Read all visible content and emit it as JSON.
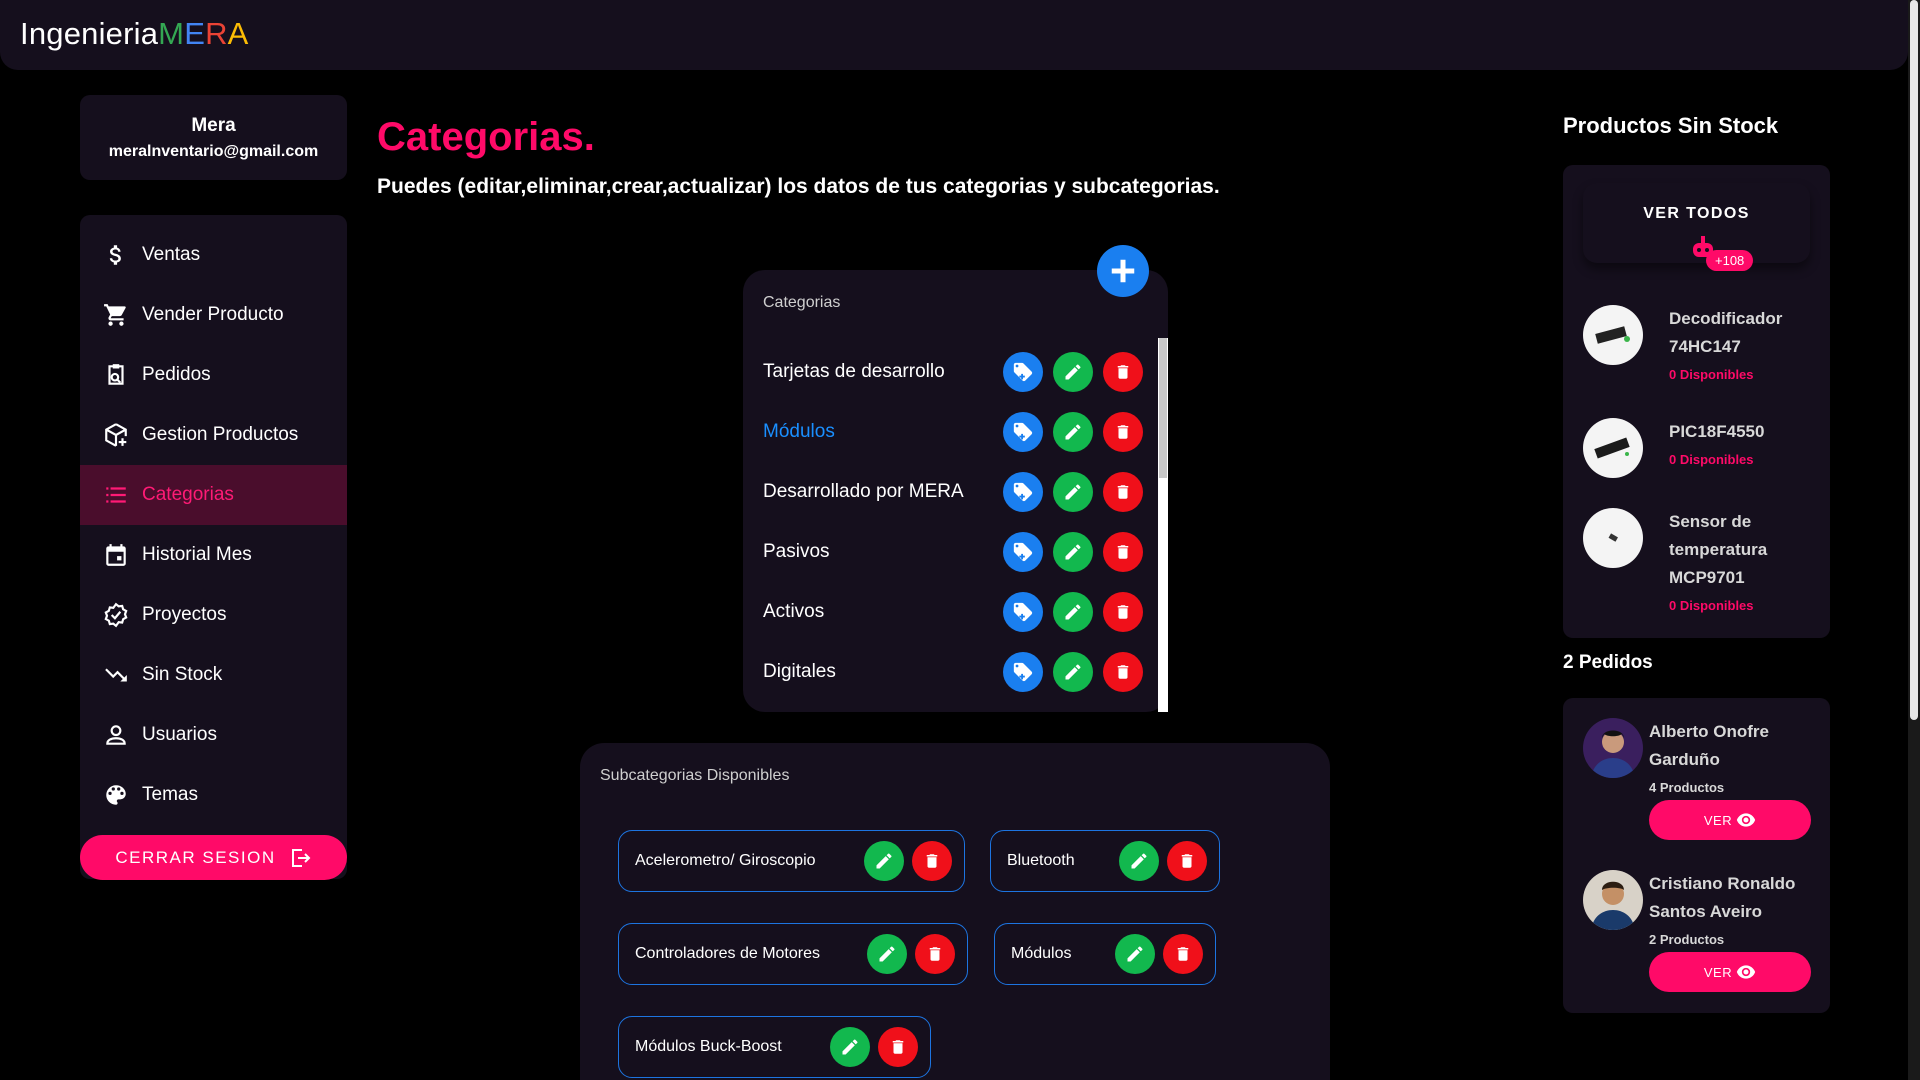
{
  "brand": {
    "prefix": "Ingenieria",
    "m": "M",
    "e": "E",
    "r": "R",
    "a": "A"
  },
  "profile": {
    "name": "Mera",
    "email": "meralnventario@gmail.com"
  },
  "sidebar": {
    "items": [
      {
        "label": "Ventas",
        "icon": "dollar-icon"
      },
      {
        "label": "Vender Producto",
        "icon": "cart-icon"
      },
      {
        "label": "Pedidos",
        "icon": "orders-icon"
      },
      {
        "label": "Gestion Productos",
        "icon": "box-add-icon"
      },
      {
        "label": "Categorias",
        "icon": "list-icon",
        "active": true
      },
      {
        "label": "Historial Mes",
        "icon": "calendar-icon"
      },
      {
        "label": "Proyectos",
        "icon": "verified-icon"
      },
      {
        "label": "Sin Stock",
        "icon": "trending-down-icon"
      },
      {
        "label": "Usuarios",
        "icon": "user-icon"
      },
      {
        "label": "Temas",
        "icon": "palette-icon"
      }
    ],
    "logout_label": "CERRAR SESION"
  },
  "main": {
    "title": "Categorias.",
    "subtitle": "Puedes (editar,eliminar,crear,actualizar) los datos de tus categorias y subcategorias."
  },
  "categories": {
    "header": "Categorias",
    "items": [
      "Tarjetas de desarrollo",
      "Módulos",
      "Desarrollado por MERA",
      "Pasivos",
      "Activos",
      "Digitales"
    ],
    "highlighted": "Módulos"
  },
  "subcategories": {
    "header": "Subcategorias Disponibles",
    "items": [
      "Acelerometro/ Giroscopio",
      "Bluetooth",
      "Controladores de Motores",
      "Módulos",
      "Módulos Buck-Boost"
    ]
  },
  "out_of_stock": {
    "title": "Productos Sin Stock",
    "view_all": "VER TODOS",
    "badge": "+108",
    "products": [
      {
        "name": "Decodificador 74HC147",
        "availability": "0 Disponibles"
      },
      {
        "name": "PIC18F4550",
        "availability": "0 Disponibles"
      },
      {
        "name": "Sensor de temperatura MCP9701",
        "availability": "0 Disponibles"
      }
    ]
  },
  "orders": {
    "title": "2 Pedidos",
    "items": [
      {
        "name": "Alberto Onofre Garduño",
        "count": "4 Productos",
        "button": "VER"
      },
      {
        "name": "Cristiano Ronaldo Santos Aveiro",
        "count": "2 Productos",
        "button": "VER"
      }
    ]
  },
  "colors": {
    "accent": "#ff0a68",
    "panel": "#150f1d",
    "blue": "#1a7ff0",
    "green": "#12b84e",
    "red": "#f0101a"
  }
}
